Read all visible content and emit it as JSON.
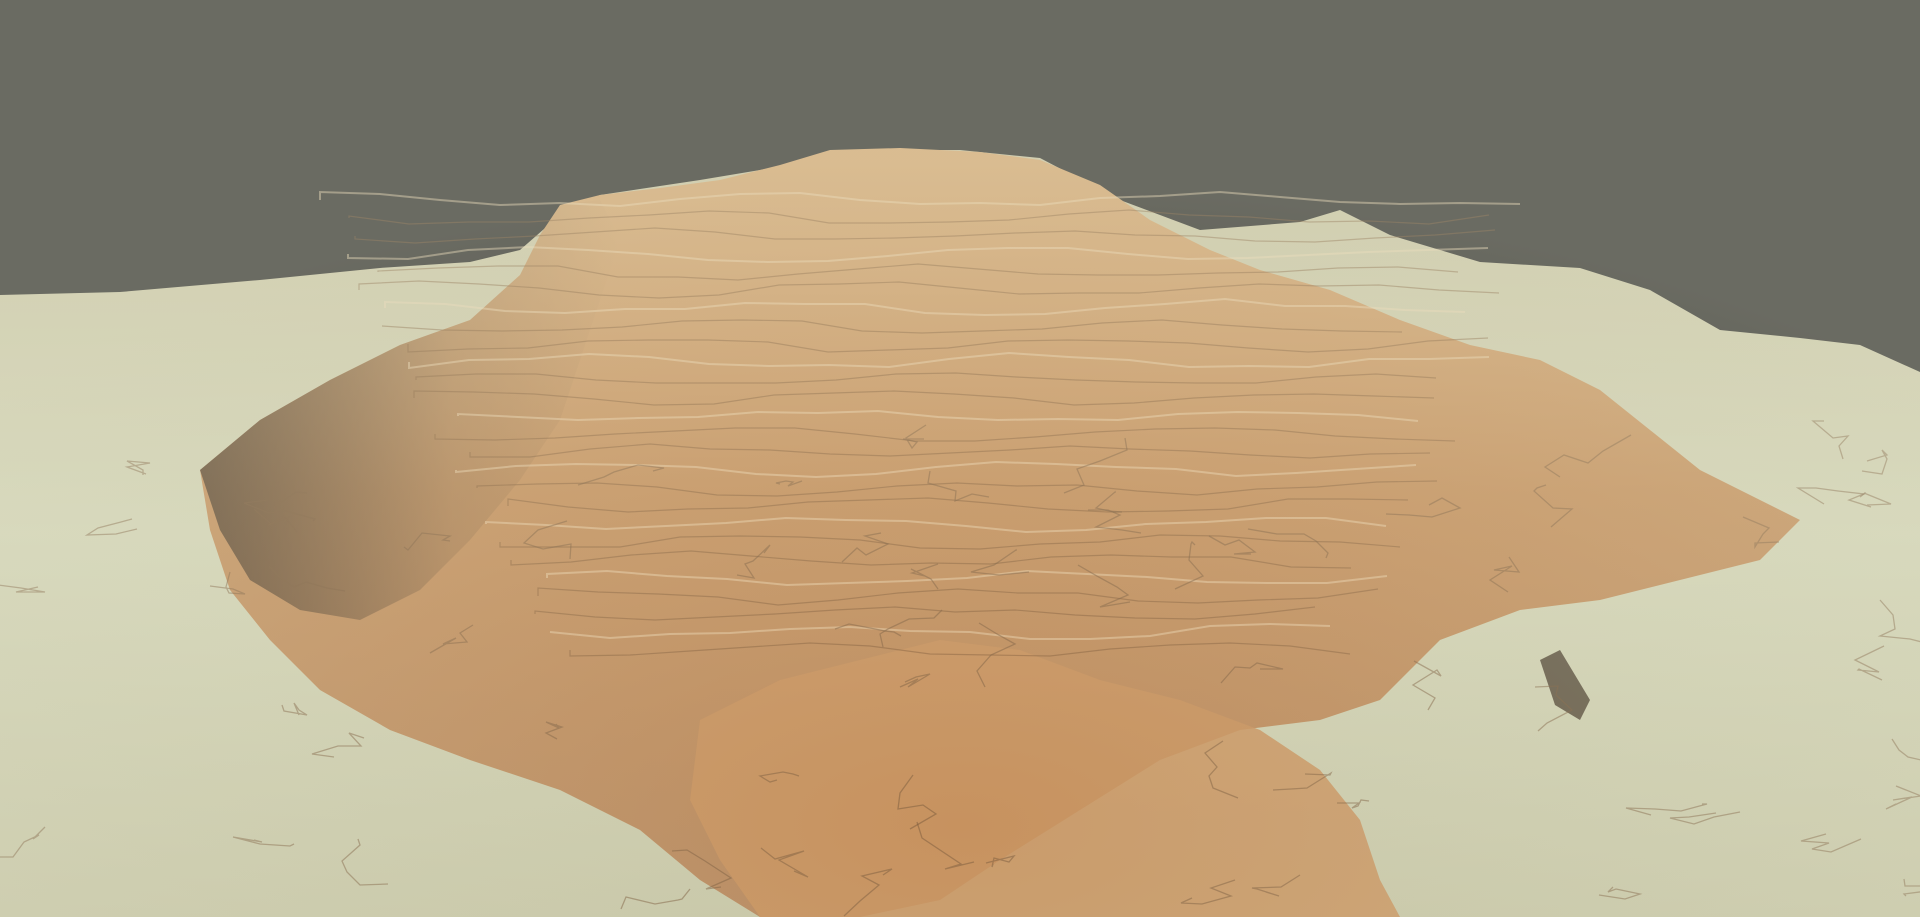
{
  "scene": {
    "subject": "terrain",
    "colors": {
      "background": "#2b2b2b",
      "pale_ground": "#cfd3b6",
      "sand": "#d9a978",
      "rock_orange": "#c78a55",
      "rock_dark": "#6d4a2e",
      "shadow": "#3e2f22"
    }
  }
}
